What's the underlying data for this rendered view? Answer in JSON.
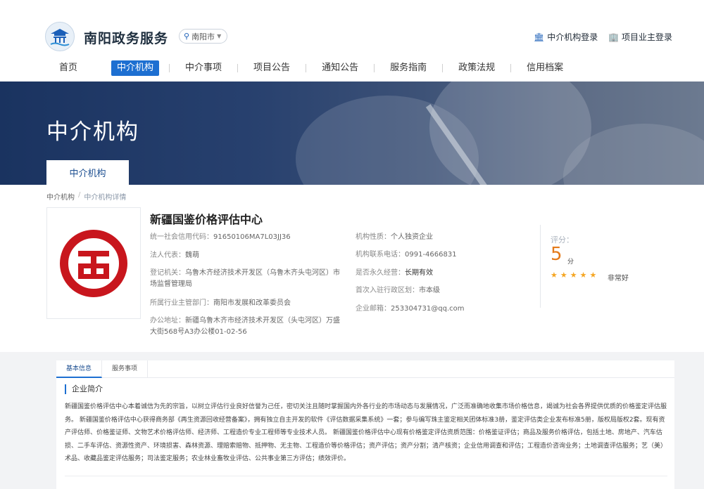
{
  "header": {
    "site_title": "南阳政务服务",
    "city": "南阳市",
    "agency_login": "中介机构登录",
    "owner_login": "项目业主登录"
  },
  "nav": {
    "items": [
      {
        "label": "首页"
      },
      {
        "label": "中介机构"
      },
      {
        "label": "中介事项"
      },
      {
        "label": "项目公告"
      },
      {
        "label": "通知公告"
      },
      {
        "label": "服务指南"
      },
      {
        "label": "政策法规"
      },
      {
        "label": "信用档案"
      }
    ]
  },
  "banner": {
    "title": "中介机构",
    "tab": "中介机构"
  },
  "breadcrumb": {
    "root": "中介机构",
    "separator": "/",
    "current": "中介机构详情"
  },
  "org": {
    "name": "新疆国鉴价格评估中心",
    "logo_color": "#c8161d",
    "credit_code_label": "统一社会信用代码：",
    "credit_code": "91650106MA7L03JJ36",
    "legal_rep_label": "法人代表：",
    "legal_rep": "魏萌",
    "reg_authority_label": "登记机关：",
    "reg_authority_line1": "乌鲁木齐经济技术开发区（乌鲁木齐头屯河区）市",
    "reg_authority_line2": "场监督管理局",
    "industry_label": "所属行业主管部门：",
    "industry": "南阳市发展和改革委员会",
    "address_label": "办公地址：",
    "address_line1": "新疆乌鲁木齐市经济技术开发区（头屯河区）万盛",
    "address_line2": "大街568号A3办公楼01-02-56",
    "nature_label": "机构性质：",
    "nature": "个人独资企业",
    "phone_label": "机构联系电话：",
    "phone": "0991-4666831",
    "permanent_label": "是否永久经营：",
    "permanent": "长期有效",
    "region_label": "首次入驻行政区划：",
    "region": "市本级",
    "email_label": "企业邮箱：",
    "email": "253304731@qq.com"
  },
  "rating": {
    "label": "评分：",
    "score": "5",
    "unit": "分",
    "stars": 5,
    "word": "非常好",
    "star_color": "#f5a623"
  },
  "detail": {
    "tabs": [
      {
        "label": "基本信息"
      },
      {
        "label": "服务事项"
      }
    ],
    "section_title": "企业简介",
    "intro": "新疆国鉴价格评估中心本着诚信为先的宗旨，以树立评估行业良好信誉为己任，密切关注且随时掌握国内外各行业的市场动态与发展情况，广泛而准确地收集市场价格信息，竭诚为社会各界提供优质的价格鉴定评估服务。 新疆国鉴价格评估中心获得商务部《再生资源回收经营备案》，拥有独立自主开发的软件《评估数据采集系统》一套；参与编写珠主鉴定相关团体标准3册，鉴定评估类企业发布标准5册，版权局版权2套。现有资产评估师、价格鉴证师、文物艺术价格评估师、经济师、工程造价专业工程师等专业技术人员。 新疆国鉴价格评估中心现有价格鉴定评估资质范围：价格鉴证评估；商品及服务价格评估，包括土地、房地产、汽车估损、二手车评估、资源性资产、环境损害、森林资源、理赔索赔物、抵押物、无主物、工程造价等价格评估；资产评估；资产分割；清产核资；企业信用调查和评估；工程造价咨询业务；土地调查评估服务；艺（美）术品、收藏品鉴定评估服务；司法鉴定服务；农业林业畜牧业评估、公共事业第三方评估；绩效评价。"
  }
}
